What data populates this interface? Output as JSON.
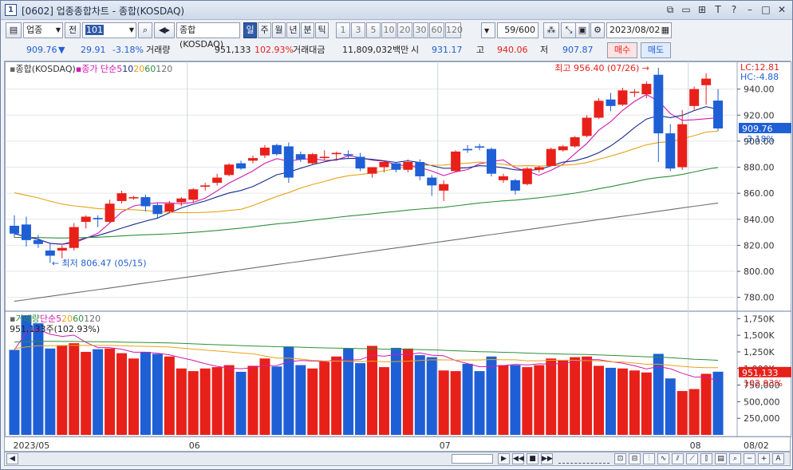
{
  "window": {
    "number": "1",
    "title": "[0602] 업종종합차트 - 종합(KOSDAQ)",
    "icons": [
      "link-icon",
      "restore-icon",
      "copy-icon",
      "font-icon",
      "help-icon",
      "minimize-icon",
      "maximize-icon",
      "close-icon"
    ]
  },
  "toolbar": {
    "market_select": "업종",
    "all_label": "전",
    "code_value": "101",
    "code_name": "종합(KOSDAQ)",
    "periods": [
      "일",
      "주",
      "월",
      "년",
      "분",
      "틱"
    ],
    "selected_period": "일",
    "intervals": [
      "1",
      "3",
      "5",
      "10",
      "20",
      "30",
      "60",
      "120"
    ],
    "count_value": "59",
    "count_total": "/600",
    "date_value": "2023/08/02"
  },
  "quote": {
    "price": "909.76",
    "change_arrow": "▼",
    "change": "29.91",
    "change_pct": "-3.18%",
    "volume_label": "거래량",
    "volume": "951,133",
    "volume_pct": "102.93%",
    "amount_label": "거래대금",
    "amount": "11,809,032백만",
    "open_label": "시",
    "open": "931.17",
    "high_label": "고",
    "high": "940.06",
    "low_label": "저",
    "low": "907.87",
    "buy_label": "매수",
    "sell_label": "매도"
  },
  "colors": {
    "up": "#e8201a",
    "down": "#1f5fd6",
    "ma5": "#d01ab0",
    "ma10": "#1a2a8c",
    "ma20": "#e6a417",
    "ma60": "#2f8f3a",
    "ma120": "#6e6e6e"
  },
  "legend": {
    "price_title": "종합(KOSDAQ)",
    "price_ma": "종가 단순",
    "ma_periods": [
      "5",
      "10",
      "20",
      "60",
      "120"
    ],
    "volume_title": "거래량",
    "volume_ma": "단순",
    "volume_info": "951,133주(102.93%)"
  },
  "annotations": {
    "lc": "LC:12.81",
    "hc": "HC:-4.88",
    "high_marker": "최고 956.40 (07/26)",
    "low_marker": "최저 806.47 (05/15)",
    "price_tag": "909.76",
    "pct_tag": "-3.18%",
    "vol_tag": "951,133",
    "vol_pct_tag": "102.93%"
  },
  "axes": {
    "price_ticks": [
      "940.00",
      "920.00",
      "900.00",
      "880.00",
      "860.00",
      "840.00",
      "820.00",
      "800.00",
      "780.00"
    ],
    "volume_ticks": [
      "1,750K",
      "1,500K",
      "1,250K",
      "1,000K",
      "750,000",
      "500,000",
      "250,000"
    ],
    "x_labels": [
      "2023/05",
      "06",
      "07",
      "08"
    ],
    "x_right_label": "08/02"
  },
  "chart_data": {
    "type": "candlestick",
    "title": "종합(KOSDAQ)",
    "price_ylim": [
      770,
      960
    ],
    "volume_ylim": [
      0,
      1850000
    ],
    "candles": [
      {
        "o": 835,
        "h": 843,
        "l": 826,
        "c": 829,
        "v": 1280000
      },
      {
        "o": 836,
        "h": 842,
        "l": 819,
        "c": 824,
        "v": 1800000
      },
      {
        "o": 824,
        "h": 828,
        "l": 818,
        "c": 821,
        "v": 1680000
      },
      {
        "o": 816,
        "h": 822,
        "l": 806.47,
        "c": 812,
        "v": 1300000
      },
      {
        "o": 816,
        "h": 820,
        "l": 810,
        "c": 818,
        "v": 1350000
      },
      {
        "o": 818,
        "h": 837,
        "l": 816,
        "c": 834,
        "v": 1380000
      },
      {
        "o": 838,
        "h": 843,
        "l": 833,
        "c": 842,
        "v": 1250000
      },
      {
        "o": 841,
        "h": 843,
        "l": 834,
        "c": 840,
        "v": 1290000
      },
      {
        "o": 838,
        "h": 855,
        "l": 837,
        "c": 852,
        "v": 1300000
      },
      {
        "o": 854,
        "h": 862,
        "l": 852,
        "c": 860,
        "v": 1230000
      },
      {
        "o": 856,
        "h": 858,
        "l": 855,
        "c": 857,
        "v": 1150000
      },
      {
        "o": 857,
        "h": 859,
        "l": 846,
        "c": 850,
        "v": 1250000
      },
      {
        "o": 851,
        "h": 853,
        "l": 841,
        "c": 844,
        "v": 1220000
      },
      {
        "o": 846,
        "h": 854,
        "l": 845,
        "c": 852,
        "v": 1180000
      },
      {
        "o": 853,
        "h": 857,
        "l": 850,
        "c": 856,
        "v": 1000000
      },
      {
        "o": 855,
        "h": 864,
        "l": 853,
        "c": 863,
        "v": 960000
      },
      {
        "o": 865,
        "h": 868,
        "l": 862,
        "c": 866,
        "v": 1000000
      },
      {
        "o": 868,
        "h": 875,
        "l": 866,
        "c": 872,
        "v": 1020000
      },
      {
        "o": 874,
        "h": 883,
        "l": 873,
        "c": 882,
        "v": 1050000
      },
      {
        "o": 883,
        "h": 885,
        "l": 878,
        "c": 879,
        "v": 950000
      },
      {
        "o": 885,
        "h": 889,
        "l": 883,
        "c": 887,
        "v": 1040000
      },
      {
        "o": 889,
        "h": 897,
        "l": 887,
        "c": 895,
        "v": 1150000
      },
      {
        "o": 897,
        "h": 898,
        "l": 889,
        "c": 890,
        "v": 1030000
      },
      {
        "o": 896,
        "h": 899,
        "l": 868,
        "c": 872,
        "v": 1330000
      },
      {
        "o": 890,
        "h": 892,
        "l": 884,
        "c": 886,
        "v": 1050000
      },
      {
        "o": 883,
        "h": 891,
        "l": 882,
        "c": 890,
        "v": 1000000
      },
      {
        "o": 887,
        "h": 893,
        "l": 885,
        "c": 888,
        "v": 1100000
      },
      {
        "o": 890,
        "h": 892,
        "l": 885,
        "c": 891,
        "v": 1180000
      },
      {
        "o": 890,
        "h": 893,
        "l": 887,
        "c": 889,
        "v": 1300000
      },
      {
        "o": 888,
        "h": 891,
        "l": 877,
        "c": 879,
        "v": 1080000
      },
      {
        "o": 875,
        "h": 880,
        "l": 872,
        "c": 880,
        "v": 1340000
      },
      {
        "o": 880,
        "h": 885,
        "l": 876,
        "c": 884,
        "v": 1020000
      },
      {
        "o": 883,
        "h": 884,
        "l": 876,
        "c": 878,
        "v": 1310000
      },
      {
        "o": 878,
        "h": 886,
        "l": 876,
        "c": 884,
        "v": 1300000
      },
      {
        "o": 884,
        "h": 886,
        "l": 870,
        "c": 873,
        "v": 1200000
      },
      {
        "o": 872,
        "h": 874,
        "l": 858,
        "c": 866,
        "v": 1170000
      },
      {
        "o": 862,
        "h": 870,
        "l": 854,
        "c": 867,
        "v": 970000
      },
      {
        "o": 877,
        "h": 893,
        "l": 876,
        "c": 892,
        "v": 960000
      },
      {
        "o": 894,
        "h": 897,
        "l": 891,
        "c": 893,
        "v": 1070000
      },
      {
        "o": 896,
        "h": 898,
        "l": 893,
        "c": 895,
        "v": 960000
      },
      {
        "o": 894,
        "h": 895,
        "l": 873,
        "c": 875,
        "v": 1180000
      },
      {
        "o": 870,
        "h": 875,
        "l": 868,
        "c": 873,
        "v": 1050000
      },
      {
        "o": 870,
        "h": 871,
        "l": 859,
        "c": 862,
        "v": 1050000
      },
      {
        "o": 867,
        "h": 880,
        "l": 866,
        "c": 879,
        "v": 1020000
      },
      {
        "o": 878,
        "h": 881,
        "l": 876,
        "c": 880,
        "v": 1050000
      },
      {
        "o": 881,
        "h": 895,
        "l": 881,
        "c": 894,
        "v": 1150000
      },
      {
        "o": 893,
        "h": 897,
        "l": 892,
        "c": 896,
        "v": 1120000
      },
      {
        "o": 896,
        "h": 904,
        "l": 895,
        "c": 903,
        "v": 1170000
      },
      {
        "o": 904,
        "h": 920,
        "l": 903,
        "c": 918,
        "v": 1180000
      },
      {
        "o": 918,
        "h": 933,
        "l": 917,
        "c": 931,
        "v": 1040000
      },
      {
        "o": 932,
        "h": 937,
        "l": 923,
        "c": 927,
        "v": 1010000
      },
      {
        "o": 928,
        "h": 941,
        "l": 927,
        "c": 939,
        "v": 1000000
      },
      {
        "o": 938,
        "h": 940,
        "l": 934,
        "c": 938,
        "v": 970000
      },
      {
        "o": 936,
        "h": 946,
        "l": 933,
        "c": 944,
        "v": 940000
      },
      {
        "o": 951,
        "h": 956.4,
        "l": 884,
        "c": 906,
        "v": 1220000
      },
      {
        "o": 906,
        "h": 913,
        "l": 877,
        "c": 879,
        "v": 850000
      },
      {
        "o": 880,
        "h": 924,
        "l": 878,
        "c": 913,
        "v": 660000
      },
      {
        "o": 927,
        "h": 942,
        "l": 924,
        "c": 940,
        "v": 690000
      },
      {
        "o": 943,
        "h": 952,
        "l": 928,
        "c": 948,
        "v": 920000
      },
      {
        "o": 931.17,
        "h": 940.06,
        "l": 907.87,
        "c": 909.76,
        "v": 951133
      }
    ],
    "series": [
      {
        "name": "5",
        "type": "line"
      },
      {
        "name": "10",
        "type": "line"
      },
      {
        "name": "20",
        "type": "line"
      },
      {
        "name": "60",
        "type": "line"
      },
      {
        "name": "120",
        "type": "line"
      }
    ]
  }
}
